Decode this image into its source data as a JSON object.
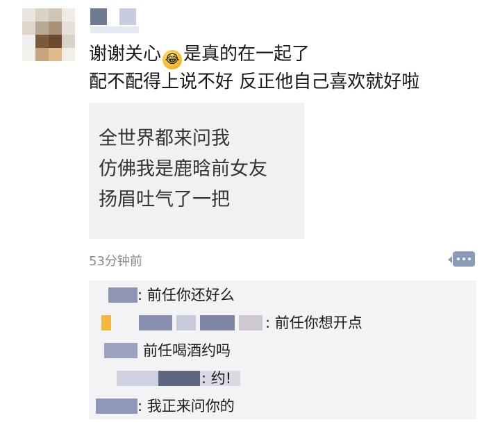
{
  "post": {
    "line1_before": "谢谢关心",
    "line1_after": "是真的在一起了",
    "line2": "配不配得上说不好 反正他自己喜欢就好啦",
    "emoji_icon": "laughing-crying-emoji"
  },
  "image": {
    "lines": [
      "全世界都来问我",
      "仿佛我是鹿晗前女友",
      "扬眉吐气了一把"
    ]
  },
  "meta": {
    "timestamp": "53分钟前"
  },
  "comments": [
    {
      "text": ": 前任你还好么"
    },
    {
      "text": ": 前任你想开点"
    },
    {
      "text": "前任喝酒约吗"
    },
    {
      "text": ": 约!"
    },
    {
      "text": ": 我正来问你的"
    }
  ],
  "colors": {
    "comment_bg": "#f3f3f5",
    "comment_button": "#8a9bb8",
    "timestamp": "#8a8a8a"
  }
}
